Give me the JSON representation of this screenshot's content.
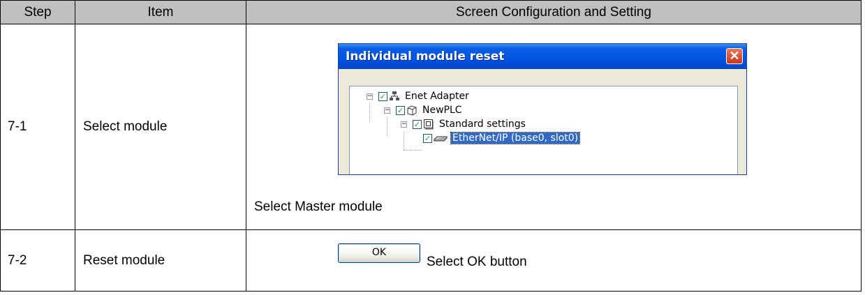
{
  "table": {
    "headers": {
      "step": "Step",
      "item": "Item",
      "config": "Screen Configuration and Setting"
    },
    "rows": [
      {
        "step": "7-1",
        "item": "Select module",
        "caption": "Select Master module",
        "dialog": {
          "title": "Individual module reset",
          "close_symbol": "✕",
          "tree": [
            {
              "label": "Enet Adapter",
              "checked": true,
              "icon": "network-adapter-icon"
            },
            {
              "label": "NewPLC",
              "checked": true,
              "icon": "plc-cube-icon"
            },
            {
              "label": "Standard settings",
              "checked": true,
              "icon": "settings-panel-icon"
            },
            {
              "label": "EtherNet/IP (base0, slot0)",
              "checked": true,
              "icon": "ethernet-module-icon",
              "selected": true
            }
          ]
        }
      },
      {
        "step": "7-2",
        "item": "Reset module",
        "button_label": "OK",
        "caption": "Select OK button"
      }
    ]
  }
}
